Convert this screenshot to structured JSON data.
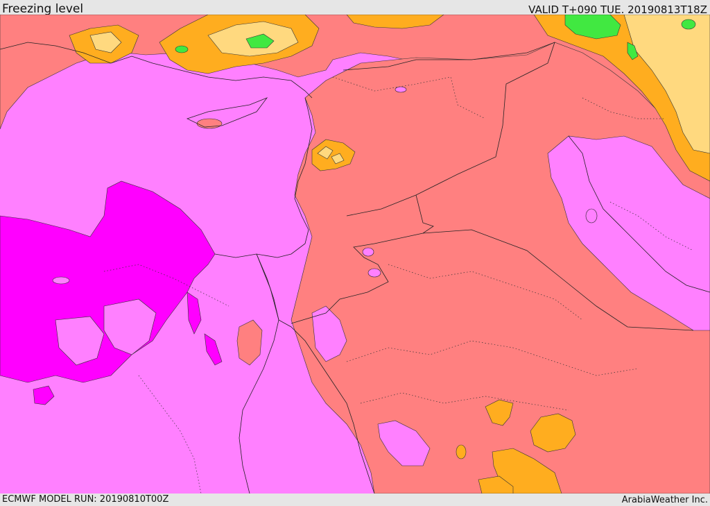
{
  "header": {
    "title": "Freezing level",
    "valid_time": "VALID T+090 TUE. 20190813T18Z"
  },
  "footer": {
    "model_run": "ECMWF MODEL RUN: 20190810T00Z",
    "credit": "ArabiaWeather Inc."
  },
  "map": {
    "field": "freezing-level",
    "colors": {
      "magenta": "#ff00ff",
      "light_magenta": "#ff80ff",
      "salmon": "#ff8080",
      "orange": "#ffad1f",
      "light_yellow": "#ffd97f",
      "green": "#41e841",
      "dark_green": "#22b022"
    }
  }
}
